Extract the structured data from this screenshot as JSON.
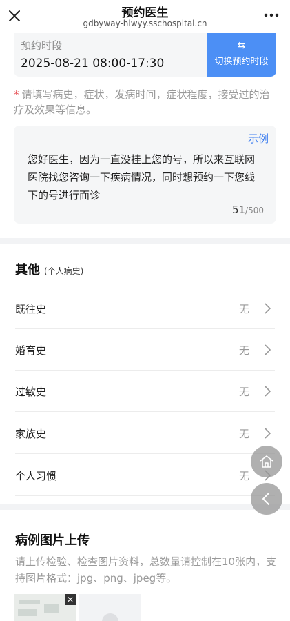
{
  "header": {
    "title": "预约医生",
    "domain": "gdbyway-hlwyy.sschospital.cn",
    "close_icon": "close-icon",
    "more_icon": "more-icon"
  },
  "appointment": {
    "label": "预约时段",
    "value": "2025-08-21 08:00-17:30",
    "switch_icon": "⇆",
    "switch_label": "切换预约时段"
  },
  "hint": {
    "star": "*",
    "text": "请填写病史，症状，发病时间，症状程度，接受过的治疗及效果等信息。"
  },
  "description": {
    "example_link": "示例",
    "text": "您好医生，因为一直没挂上您的号，所以来互联网医院找您咨询一下疾病情况，同时想预约一下您线下的号进行面诊",
    "count": "51",
    "max": "/500"
  },
  "other": {
    "title": "其他",
    "subtitle": "(个人病史)",
    "rows": [
      {
        "label": "既往史",
        "value": "无"
      },
      {
        "label": "婚育史",
        "value": "无"
      },
      {
        "label": "过敏史",
        "value": "无"
      },
      {
        "label": "家族史",
        "value": "无"
      },
      {
        "label": "个人习惯",
        "value": "无"
      }
    ]
  },
  "upload": {
    "title": "病例图片上传",
    "desc": "请上传检验、检查图片资料，总数量请控制在10张内，支持图片格式：jpg、png、jpeg等。",
    "remove_label": "✕"
  },
  "colors": {
    "accent": "#4c8ff5",
    "link": "#3f7ff0",
    "required": "#e5484d"
  }
}
